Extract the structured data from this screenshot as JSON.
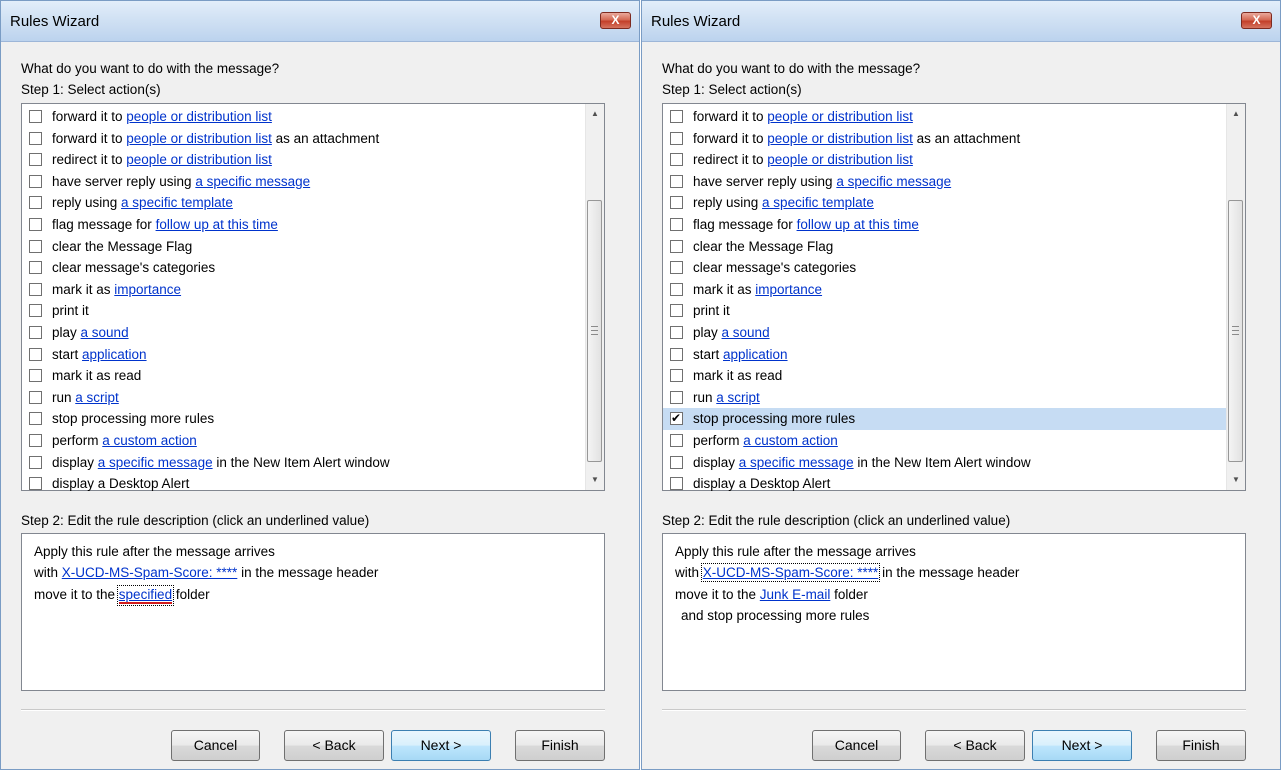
{
  "left": {
    "title": "Rules Wizard",
    "close_label": "X",
    "prompt": "What do you want to do with the message?",
    "step1_label": "Step 1: Select action(s)",
    "actions": [
      {
        "pre": "forward it to ",
        "link": "people or distribution list",
        "post": "",
        "checked": false
      },
      {
        "pre": "forward it to ",
        "link": "people or distribution list",
        "post": " as an attachment",
        "checked": false
      },
      {
        "pre": "redirect it to ",
        "link": "people or distribution list",
        "post": "",
        "checked": false
      },
      {
        "pre": "have server reply using ",
        "link": "a specific message",
        "post": "",
        "checked": false
      },
      {
        "pre": "reply using ",
        "link": "a specific template",
        "post": "",
        "checked": false
      },
      {
        "pre": "flag message for ",
        "link": "follow up at this time",
        "post": "",
        "checked": false
      },
      {
        "pre": "clear the Message Flag",
        "link": "",
        "post": "",
        "checked": false
      },
      {
        "pre": "clear message's categories",
        "link": "",
        "post": "",
        "checked": false
      },
      {
        "pre": "mark it as ",
        "link": "importance",
        "post": "",
        "checked": false
      },
      {
        "pre": "print it",
        "link": "",
        "post": "",
        "checked": false
      },
      {
        "pre": "play ",
        "link": "a sound",
        "post": "",
        "checked": false
      },
      {
        "pre": "start ",
        "link": "application",
        "post": "",
        "checked": false
      },
      {
        "pre": "mark it as read",
        "link": "",
        "post": "",
        "checked": false
      },
      {
        "pre": "run ",
        "link": "a script",
        "post": "",
        "checked": false
      },
      {
        "pre": "stop processing more rules",
        "link": "",
        "post": "",
        "checked": false
      },
      {
        "pre": "perform ",
        "link": "a custom action",
        "post": "",
        "checked": false
      },
      {
        "pre": "display ",
        "link": "a specific message",
        "post": " in the New Item Alert window",
        "checked": false
      },
      {
        "pre": "display a Desktop Alert",
        "link": "",
        "post": "",
        "checked": false
      }
    ],
    "step2_label": "Step 2: Edit the rule description (click an underlined value)",
    "description": {
      "line1": "Apply this rule after the message arrives",
      "line2_pre": "with ",
      "line2_link": "X-UCD-MS-Spam-Score: ****",
      "line2_post": " in the message header",
      "line3_pre": "move it to the ",
      "line3_link": "specified",
      "line3_post": " folder"
    },
    "buttons": {
      "cancel": "Cancel",
      "back": "< Back",
      "next": "Next >",
      "finish": "Finish"
    }
  },
  "right": {
    "title": "Rules Wizard",
    "close_label": "X",
    "prompt": "What do you want to do with the message?",
    "step1_label": "Step 1: Select action(s)",
    "actions": [
      {
        "pre": "forward it to ",
        "link": "people or distribution list",
        "post": "",
        "checked": false
      },
      {
        "pre": "forward it to ",
        "link": "people or distribution list",
        "post": " as an attachment",
        "checked": false
      },
      {
        "pre": "redirect it to ",
        "link": "people or distribution list",
        "post": "",
        "checked": false
      },
      {
        "pre": "have server reply using ",
        "link": "a specific message",
        "post": "",
        "checked": false
      },
      {
        "pre": "reply using ",
        "link": "a specific template",
        "post": "",
        "checked": false
      },
      {
        "pre": "flag message for ",
        "link": "follow up at this time",
        "post": "",
        "checked": false
      },
      {
        "pre": "clear the Message Flag",
        "link": "",
        "post": "",
        "checked": false
      },
      {
        "pre": "clear message's categories",
        "link": "",
        "post": "",
        "checked": false
      },
      {
        "pre": "mark it as ",
        "link": "importance",
        "post": "",
        "checked": false
      },
      {
        "pre": "print it",
        "link": "",
        "post": "",
        "checked": false
      },
      {
        "pre": "play ",
        "link": "a sound",
        "post": "",
        "checked": false
      },
      {
        "pre": "start ",
        "link": "application",
        "post": "",
        "checked": false
      },
      {
        "pre": "mark it as read",
        "link": "",
        "post": "",
        "checked": false
      },
      {
        "pre": "run ",
        "link": "a script",
        "post": "",
        "checked": false
      },
      {
        "pre": "stop processing more rules",
        "link": "",
        "post": "",
        "checked": true
      },
      {
        "pre": "perform ",
        "link": "a custom action",
        "post": "",
        "checked": false
      },
      {
        "pre": "display ",
        "link": "a specific message",
        "post": " in the New Item Alert window",
        "checked": false
      },
      {
        "pre": "display a Desktop Alert",
        "link": "",
        "post": "",
        "checked": false
      }
    ],
    "step2_label": "Step 2: Edit the rule description (click an underlined value)",
    "description": {
      "line1": "Apply this rule after the message arrives",
      "line2_pre": "with ",
      "line2_link": "X-UCD-MS-Spam-Score: ****",
      "line2_post": " in the message header",
      "line3_pre": "move it to the ",
      "line3_link": "Junk E-mail",
      "line3_post": " folder",
      "line4": "and stop processing more rules"
    },
    "buttons": {
      "cancel": "Cancel",
      "back": "< Back",
      "next": "Next >",
      "finish": "Finish"
    }
  }
}
